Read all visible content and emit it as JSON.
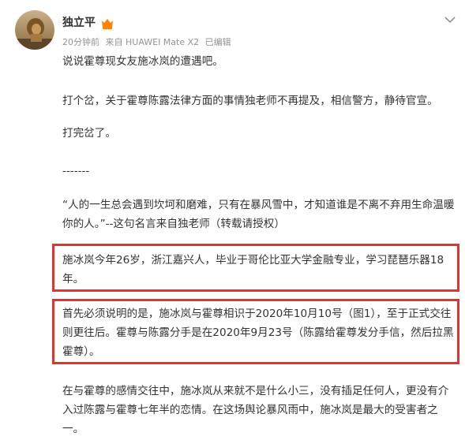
{
  "post": {
    "author": "独立平",
    "time": "20分钟前",
    "source": "来自 HUAWEI Mate X2",
    "edited": "已编辑",
    "paragraphs": [
      "说说霍尊现女友施冰岚的遭遇吧。",
      "打个岔，关于霍尊陈露法律方面的事情独老师不再提及，相信警方，静待官宣。",
      "打完岔了。",
      "-------",
      "“人的一生总会遇到坎坷和磨难，只有在暴风雪中，才知道谁是不离不弃用生命温暖你的人。”--这句名言来自独老师（转载请授权）",
      "施冰岚今年26岁，浙江嘉兴人，毕业于哥伦比亚大学金融专业，学习琵琶乐器18年。",
      "首先必须说明的是，施冰岚与霍尊相识于2020年10月10号（图1），至于正式交往则更往后。霍尊与陈露分手是在2020年9月23号（陈露给霍尊发分手信，然后拉黑霍尊）。",
      "在与霍尊的感情交往中，施冰岚从来就不是什么小三，没有插足任何人，更没有介入过陈露与霍尊七年半的恋情。在这场舆论暴风雨中，施冰岚是最大的受害者之一。"
    ]
  },
  "icons": {
    "badge": "vip-badge-icon",
    "menu": "chevron-down-icon",
    "avatar": "lion-avatar"
  },
  "colors": {
    "highlight_border": "#e5322d",
    "badge": "#ff8200",
    "meta": "#939393",
    "text": "#333333"
  }
}
